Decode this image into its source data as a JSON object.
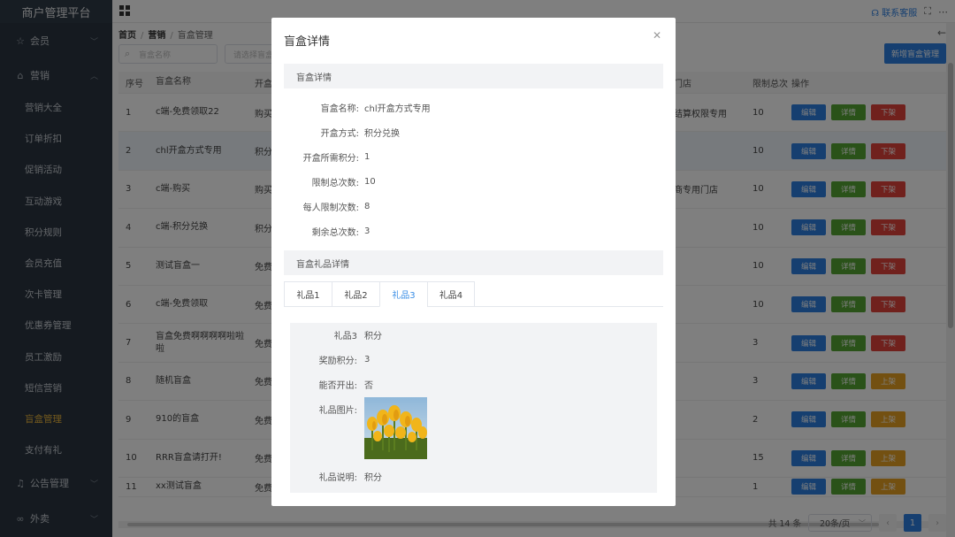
{
  "app": {
    "title": "商户管理平台"
  },
  "sidebar": {
    "groups": [
      {
        "label": "会员",
        "icon": "star-icon"
      },
      {
        "label": "营销",
        "icon": "shop-icon"
      }
    ],
    "items": [
      {
        "label": "营销大全"
      },
      {
        "label": "订单折扣"
      },
      {
        "label": "促销活动"
      },
      {
        "label": "互动游戏"
      },
      {
        "label": "积分规则"
      },
      {
        "label": "会员充值"
      },
      {
        "label": "次卡管理"
      },
      {
        "label": "优惠券管理"
      },
      {
        "label": "员工激励"
      },
      {
        "label": "短信营销"
      },
      {
        "label": "盲盒管理"
      },
      {
        "label": "支付有礼"
      }
    ],
    "bottom_groups": [
      {
        "label": "公告管理",
        "icon": "bell-icon"
      },
      {
        "label": "外卖",
        "icon": "bike-icon"
      }
    ]
  },
  "topbar": {
    "contact": "联系客服"
  },
  "breadcrumb": {
    "home": "首页",
    "marketing": "营销",
    "current": "盲盒管理"
  },
  "filters": {
    "name_placeholder": "盲盒名称",
    "open_placeholder": "请选择盲盒"
  },
  "actions": {
    "new": "新增盲盒管理"
  },
  "table": {
    "headers": {
      "no": "序号",
      "name": "盲盒名称",
      "open": "开盒",
      "store": "门店",
      "limit": "限制总次",
      "ops": "操作"
    },
    "rows": [
      {
        "no": "1",
        "name": "c端-免费领取22",
        "open": "购买",
        "store": "结算权限专用",
        "limit": "10",
        "op3": "下架",
        "op3_color": "red"
      },
      {
        "no": "2",
        "name": "chl开盒方式专用",
        "open": "积分",
        "store": "",
        "limit": "10",
        "op3": "下架",
        "op3_color": "red"
      },
      {
        "no": "3",
        "name": "c端-购买",
        "open": "购买",
        "store": "商专用门店",
        "limit": "10",
        "op3": "下架",
        "op3_color": "red"
      },
      {
        "no": "4",
        "name": "c端-积分兑换",
        "open": "积分",
        "store": "",
        "limit": "10",
        "op3": "下架",
        "op3_color": "red"
      },
      {
        "no": "5",
        "name": "测试盲盒一",
        "open": "免费",
        "store": "",
        "limit": "10",
        "op3": "下架",
        "op3_color": "red"
      },
      {
        "no": "6",
        "name": "c端-免费领取",
        "open": "免费",
        "store": "",
        "limit": "10",
        "op3": "下架",
        "op3_color": "red"
      },
      {
        "no": "7",
        "name": "盲盒免费啊啊啊啊啦啦啦",
        "open": "免费",
        "store": "",
        "limit": "3",
        "op3": "下架",
        "op3_color": "red"
      },
      {
        "no": "8",
        "name": "随机盲盒",
        "open": "免费",
        "store": "",
        "limit": "3",
        "op3": "上架",
        "op3_color": "orange"
      },
      {
        "no": "9",
        "name": "910的盲盒",
        "open": "免费",
        "store": "",
        "limit": "2",
        "op3": "上架",
        "op3_color": "orange"
      },
      {
        "no": "10",
        "name": "RRR盲盒请打开!",
        "open": "免费",
        "store": "",
        "limit": "15",
        "op3": "上架",
        "op3_color": "orange"
      },
      {
        "no": "11",
        "name": "xx测试盲盒",
        "open": "免费",
        "store": "",
        "limit": "1",
        "op3": "上架",
        "op3_color": "orange"
      }
    ],
    "edit": "编辑",
    "detail": "详情"
  },
  "pagination": {
    "total": "共 14 条",
    "size": "20条/页",
    "current": "1"
  },
  "modal": {
    "title": "盲盒详情",
    "section1": "盲盒详情",
    "fields": [
      {
        "label": "盲盒名称:",
        "value": "chl开盒方式专用"
      },
      {
        "label": "开盒方式:",
        "value": "积分兑换"
      },
      {
        "label": "开盒所需积分:",
        "value": "1"
      },
      {
        "label": "限制总次数:",
        "value": "10"
      },
      {
        "label": "每人限制次数:",
        "value": "8"
      },
      {
        "label": "剩余总次数:",
        "value": "3"
      }
    ],
    "section2": "盲盒礼品详情",
    "tabs": [
      "礼品1",
      "礼品2",
      "礼品3",
      "礼品4"
    ],
    "active_tab": 2,
    "gift": {
      "type_label": "礼品3",
      "type_value": "积分",
      "points_label": "奖励积分:",
      "points_value": "3",
      "open_label": "能否开出:",
      "open_value": "否",
      "image_label": "礼品图片:",
      "desc_label": "礼品说明:",
      "desc_value": "积分"
    }
  },
  "colors": {
    "primary": "#2d7fe0",
    "success": "#55a532",
    "danger": "#e0423a",
    "warning": "#e6a023",
    "sidebar": "#2b3541",
    "active_menu": "#e6b33c"
  }
}
